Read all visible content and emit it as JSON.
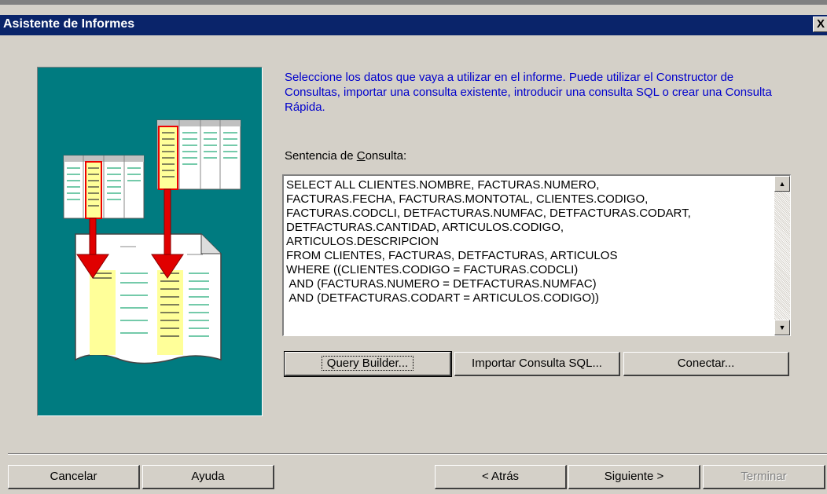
{
  "window": {
    "title": "Asistente de Informes",
    "close_label": "X"
  },
  "description": "Seleccione los datos que vaya a utilizar en el informe. Puede utilizar el Constructor de Consultas, importar una consulta existente, introducir una consulta SQL o crear una Consulta Rápida.",
  "sql": {
    "label_pre": "Sentencia de ",
    "label_accel": "C",
    "label_post": "onsulta:",
    "query": "SELECT ALL CLIENTES.NOMBRE, FACTURAS.NUMERO,\nFACTURAS.FECHA, FACTURAS.MONTOTAL, CLIENTES.CODIGO,\nFACTURAS.CODCLI, DETFACTURAS.NUMFAC, DETFACTURAS.CODART,\nDETFACTURAS.CANTIDAD, ARTICULOS.CODIGO,\nARTICULOS.DESCRIPCION\nFROM CLIENTES, FACTURAS, DETFACTURAS, ARTICULOS\nWHERE ((CLIENTES.CODIGO = FACTURAS.CODCLI)\n AND (FACTURAS.NUMERO = DETFACTURAS.NUMFAC)\n AND (DETFACTURAS.CODART = ARTICULOS.CODIGO))"
  },
  "buttons": {
    "query_builder": "Query Builder...",
    "import_sql": "Importar Consulta SQL...",
    "connect": "Conectar...",
    "cancel": "Cancelar",
    "help": "Ayuda",
    "back": "< Atrás",
    "next": "Siguiente >",
    "finish": "Terminar"
  },
  "colors": {
    "title_bar": "#0a246a",
    "illustration_bg": "#007b80",
    "description_text": "#0000cc"
  }
}
